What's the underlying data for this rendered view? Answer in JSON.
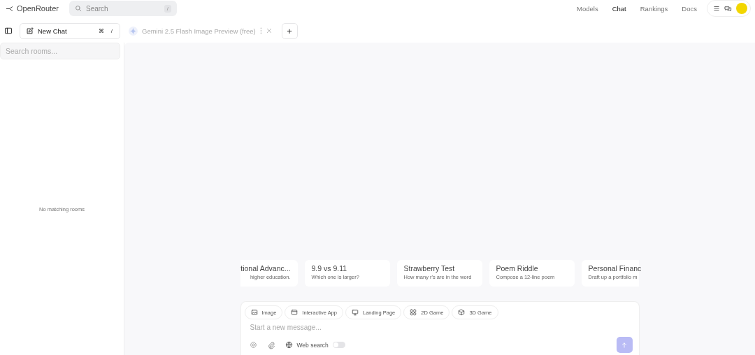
{
  "header": {
    "brand": "OpenRouter",
    "search": {
      "placeholder": "Search",
      "shortcut": "/"
    },
    "nav": [
      {
        "label": "Models",
        "selected": false
      },
      {
        "label": "Chat",
        "selected": true
      },
      {
        "label": "Rankings",
        "selected": false
      },
      {
        "label": "Docs",
        "selected": false
      }
    ]
  },
  "toolbar": {
    "new_chat": "New Chat",
    "shortcut_key": "⌘",
    "shortcut_slash": "/",
    "tab": {
      "label": "Gemini 2.5 Flash Image Preview (free)"
    },
    "add": "+"
  },
  "sidebar": {
    "search": {
      "placeholder": "Search rooms..."
    },
    "empty": "No matching rooms"
  },
  "suggestions": [
    {
      "title": "tional Advanc...",
      "subtitle": "higher education."
    },
    {
      "title": "9.9 vs 9.11",
      "subtitle": "Which one is larger?"
    },
    {
      "title": "Strawberry Test",
      "subtitle": "How many r's are in the word"
    },
    {
      "title": "Poem Riddle",
      "subtitle": "Compose a 12-line poem"
    },
    {
      "title": "Personal Financ",
      "subtitle": "Draft up a portfolio m"
    }
  ],
  "composer": {
    "chips": [
      {
        "kind": "image",
        "label": "Image"
      },
      {
        "kind": "app",
        "label": "Interactive App"
      },
      {
        "kind": "landing",
        "label": "Landing Page"
      },
      {
        "kind": "game2d",
        "label": "2D Game"
      },
      {
        "kind": "game3d",
        "label": "3D Game"
      }
    ],
    "placeholder": "Start a new message...",
    "web_search": {
      "label": "Web search",
      "on": false
    }
  }
}
